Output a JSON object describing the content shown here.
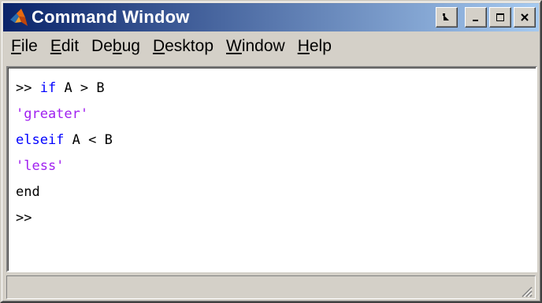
{
  "window": {
    "title": "Command Window",
    "icon": "matlab-icon",
    "buttons": [
      "undock-icon",
      "minimize-icon",
      "maximize-icon",
      "close-icon"
    ]
  },
  "menu": {
    "file": {
      "hot": "F",
      "rest": "ile"
    },
    "edit": {
      "hot": "E",
      "rest": "dit"
    },
    "debug": {
      "pre": "De",
      "hot": "b",
      "rest": "ug"
    },
    "desktop": {
      "hot": "D",
      "rest": "esktop"
    },
    "window": {
      "hot": "W",
      "rest": "indow"
    },
    "help": {
      "hot": "H",
      "rest": "elp"
    }
  },
  "console": {
    "lines": [
      {
        "prompt": ">> ",
        "kw": "if",
        "rest": " A > B"
      },
      {
        "str": "'greater'"
      },
      {
        "kw": "elseif",
        "rest": " A < B"
      },
      {
        "str": "'less'"
      },
      {
        "rest": "end"
      },
      {
        "prompt": ">>"
      }
    ]
  },
  "colors": {
    "keyword": "#0000ff",
    "string": "#a020f0",
    "titlebar_start": "#0a246a",
    "titlebar_end": "#a6caf0",
    "chrome": "#d4d0c8"
  }
}
